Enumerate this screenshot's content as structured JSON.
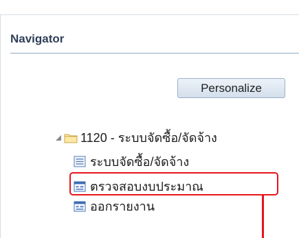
{
  "navigator": {
    "title": "Navigator",
    "personalize_label": "Personalize"
  },
  "tree": {
    "root": {
      "label": "1120 - ระบบจัดซื้อ/จัดจ้าง",
      "icon": "folder-icon",
      "expanded": true
    },
    "items": [
      {
        "label": "ระบบจัดซื้อ/จัดจ้าง",
        "icon": "document-list-icon"
      },
      {
        "label": "ตรวจสอบงบประมาณ",
        "icon": "form-window-icon",
        "highlighted": true
      },
      {
        "label": "ออกรายงาน",
        "icon": "form-window-icon"
      }
    ]
  },
  "colors": {
    "highlight": "#e8131b",
    "title": "#2f3f58",
    "rule": "#8fa7c4"
  }
}
